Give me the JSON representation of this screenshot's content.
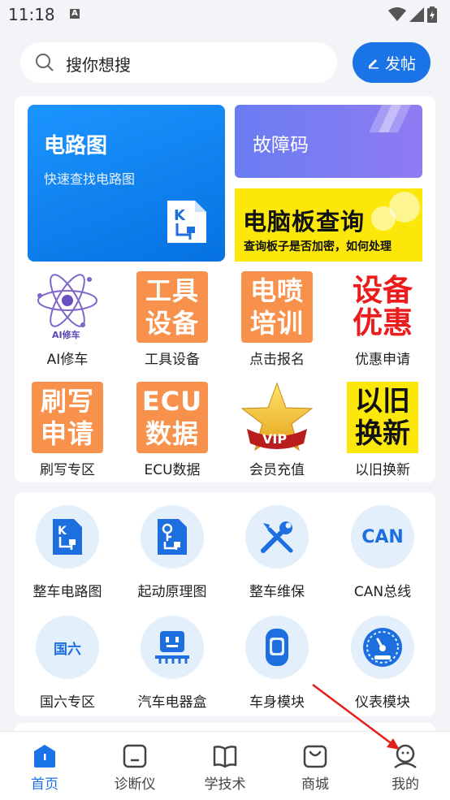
{
  "status_bar": {
    "time": "11:18",
    "notif_icon": "A"
  },
  "search": {
    "placeholder": "搜你想搜",
    "post_label": "发帖"
  },
  "feature_tiles": {
    "circuit": {
      "title": "电路图",
      "subtitle": "快速查找电路图"
    },
    "fault_code": {
      "title": "故障码"
    },
    "ecu_query": {
      "title": "电脑板查询",
      "subtitle": "查询板子是否加密，如何处理"
    }
  },
  "grid_top": [
    {
      "label": "AI修车",
      "tile_text": [
        "AI修车"
      ],
      "icon": "atom-icon"
    },
    {
      "label": "工具设备",
      "tile_text": [
        "工具",
        "设备"
      ]
    },
    {
      "label": "点击报名",
      "tile_text": [
        "电喷",
        "培训"
      ]
    },
    {
      "label": "优惠申请",
      "tile_text": [
        "设备",
        "优惠"
      ]
    },
    {
      "label": "刷写专区",
      "tile_text": [
        "刷写",
        "申请"
      ]
    },
    {
      "label": "ECU数据",
      "tile_text": [
        "ECU",
        "数据"
      ]
    },
    {
      "label": "会员充值",
      "tile_text": [
        "VIP"
      ],
      "icon": "vip-star-icon"
    },
    {
      "label": "以旧换新",
      "tile_text": [
        "以旧",
        "换新"
      ]
    }
  ],
  "grid_tools": [
    {
      "label": "整车电路图",
      "icon": "circuit-doc-icon"
    },
    {
      "label": "起动原理图",
      "icon": "key-doc-icon"
    },
    {
      "label": "整车维保",
      "icon": "wrench-screwdriver-icon"
    },
    {
      "label": "CAN总线",
      "icon": "can-icon",
      "icon_text": "CAN"
    },
    {
      "label": "国六专区",
      "icon": "guoliu-icon",
      "icon_text": "国六"
    },
    {
      "label": "汽车电器盒",
      "icon": "fuse-box-icon"
    },
    {
      "label": "车身模块",
      "icon": "car-body-icon"
    },
    {
      "label": "仪表模块",
      "icon": "gauge-icon"
    }
  ],
  "bottom_nav": [
    {
      "label": "首页",
      "active": true
    },
    {
      "label": "诊断仪",
      "active": false
    },
    {
      "label": "学技术",
      "active": false
    },
    {
      "label": "商城",
      "active": false
    },
    {
      "label": "我的",
      "active": false
    }
  ],
  "colors": {
    "brand": "#1b73e8",
    "orange": "#f8914b",
    "yellow": "#fbe80a",
    "red": "#ea1c1c"
  }
}
